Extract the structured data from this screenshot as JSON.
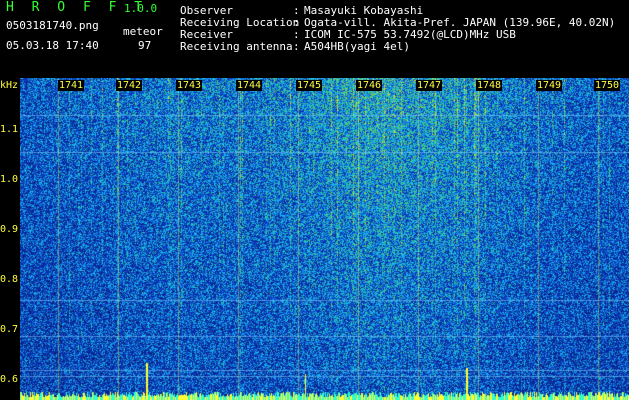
{
  "app": {
    "logo": "H R O F F T",
    "version": "1.0.0"
  },
  "file": {
    "name": "0503181740.png",
    "datetime": "05.03.18 17:40"
  },
  "meteor": {
    "label": "meteor",
    "count": "97"
  },
  "info": [
    {
      "label": "Observer",
      "value": "Masayuki Kobayashi"
    },
    {
      "label": "Receiving Location",
      "value": "Ogata-vill. Akita-Pref. JAPAN (139.96E, 40.02N)"
    },
    {
      "label": "Receiver",
      "value": "ICOM IC-575 53.7492(@LCD)MHz USB"
    },
    {
      "label": "Receiving antenna",
      "value": "A504HB(yagi 4el)"
    }
  ],
  "yaxis": {
    "unit": "kHz",
    "ticks": [
      "1.1",
      "1.0",
      "0.9",
      "0.8",
      "0.7",
      "0.6"
    ]
  },
  "xaxis": {
    "minutes": [
      "1741",
      "1742",
      "1743",
      "1744",
      "1745",
      "1746",
      "1747",
      "1748",
      "1749",
      "1750"
    ]
  },
  "colors": {
    "background": "#000000",
    "header_text": "#ffffff",
    "logo": "#33ff33",
    "axis_labels": "#ffff44",
    "waterfall_base": "#1a2a9a",
    "signal_peak": "#ffff33"
  }
}
